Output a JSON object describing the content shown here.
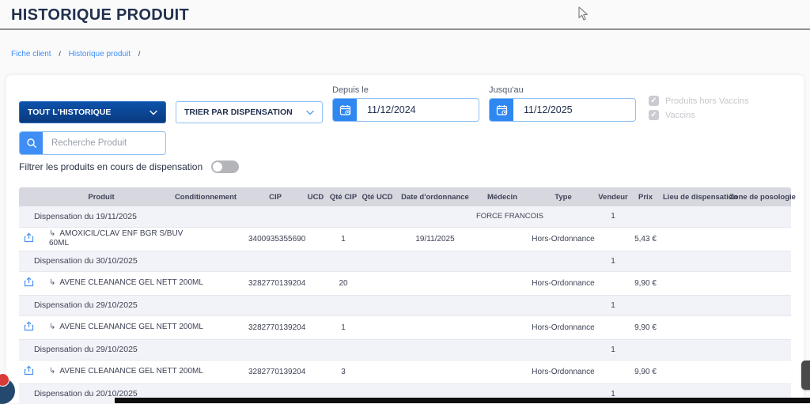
{
  "page": {
    "title": "HISTORIQUE PRODUIT"
  },
  "breadcrumb": {
    "separator": "/",
    "items": [
      "Fiche client",
      "Historique produit"
    ]
  },
  "filters": {
    "history_select": {
      "value": "TOUT L'HISTORIQUE"
    },
    "sort_select": {
      "value": "TRIER PAR DISPENSATION"
    },
    "date_from": {
      "label": "Depuis le",
      "value": "11/12/2024"
    },
    "date_to": {
      "label": "Jusqu'au",
      "value": "11/12/2025"
    },
    "checkbox_hors_vaccins": {
      "label": "Produits hors Vaccins",
      "checked": true,
      "disabled": true
    },
    "checkbox_vaccins": {
      "label": "Vaccins",
      "checked": true,
      "disabled": true
    },
    "search": {
      "placeholder": "Recherche Produit",
      "value": ""
    },
    "toggle": {
      "label": "Filtrer les produits en cours de dispensation",
      "on": false
    }
  },
  "table": {
    "columns": [
      "Produit",
      "Conditionnement",
      "CIP",
      "UCD",
      "Qté CIP",
      "Qté UCD",
      "Date d'ordonnance",
      "Médecin",
      "Type",
      "Vendeur",
      "Prix",
      "Lieu de dispensation",
      "Zone de posologie"
    ],
    "rows": [
      {
        "kind": "group",
        "label": "Dispensation du 19/11/2025",
        "medecin": "FORCE FRANCOIS",
        "vendeur": "1"
      },
      {
        "kind": "product",
        "produit": "AMOXICIL/CLAV ENF BGR S/BUV\n60ML",
        "cip": "3400935355690",
        "qte_cip": "1",
        "date_ordonnance": "19/11/2025",
        "type": "Hors-Ordonnance",
        "prix": "5,43 €"
      },
      {
        "kind": "group",
        "label": "Dispensation du 30/10/2025",
        "vendeur": "1"
      },
      {
        "kind": "product",
        "produit": "AVENE CLEANANCE GEL NETT 200ML",
        "cip": "3282770139204",
        "qte_cip": "20",
        "type": "Hors-Ordonnance",
        "prix": "9,90 €"
      },
      {
        "kind": "group",
        "label": "Dispensation du 29/10/2025",
        "vendeur": "1"
      },
      {
        "kind": "product",
        "produit": "AVENE CLEANANCE GEL NETT 200ML",
        "cip": "3282770139204",
        "qte_cip": "1",
        "type": "Hors-Ordonnance",
        "prix": "9,90 €"
      },
      {
        "kind": "group",
        "label": "Dispensation du 29/10/2025",
        "vendeur": "1"
      },
      {
        "kind": "product",
        "produit": "AVENE CLEANANCE GEL NETT 200ML",
        "cip": "3282770139204",
        "qte_cip": "3",
        "type": "Hors-Ordonnance",
        "prix": "9,90 €"
      },
      {
        "kind": "group",
        "label": "Dispensation du 20/10/2025",
        "vendeur": "1"
      }
    ]
  },
  "icons": {
    "elbow": "↳",
    "check": "✓"
  },
  "colors": {
    "accent-blue": "#3f8ef5",
    "accent-blue-strong": "#2f87f1",
    "dark-navy": "#22304f",
    "field-border": "#8fc0f2",
    "header-bg": "#d6d7df",
    "group-row-bg": "#f2f3f8",
    "disabled-grey": "#cbccd1",
    "disabled-text": "#c7c8cc",
    "toggle-off": "#b4b5ba"
  }
}
